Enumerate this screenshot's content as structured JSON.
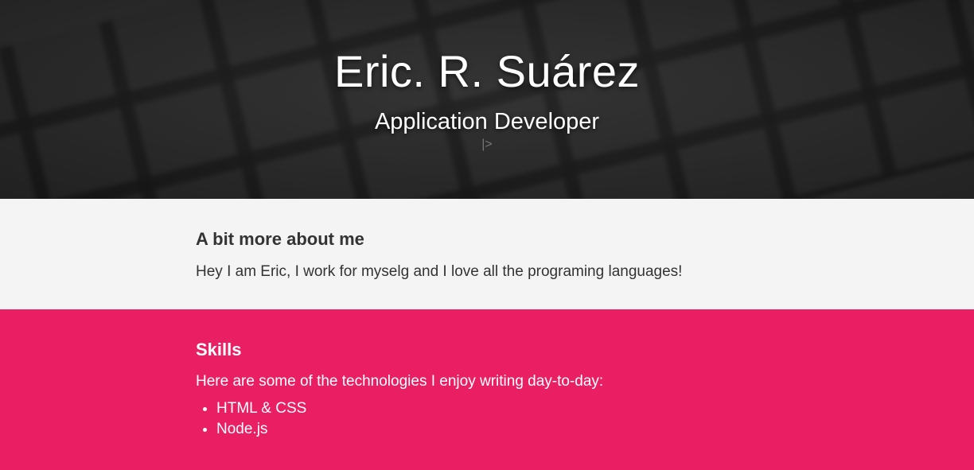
{
  "hero": {
    "title": "Eric. R. Suárez",
    "subtitle": "Application Developer",
    "cursor": "|>"
  },
  "about": {
    "heading": "A bit more about me",
    "text": "Hey I am Eric, I work for myselg and I love all the programing languages!"
  },
  "skills": {
    "heading": "Skills",
    "intro": "Here are some of the technologies I enjoy writing day-to-day:",
    "items": [
      {
        "label": "HTML & CSS"
      },
      {
        "label": "Node.js"
      }
    ]
  },
  "colors": {
    "accent": "#e91e63",
    "about_background": "#f4f4f4",
    "hero_background": "#2e2e2e"
  }
}
